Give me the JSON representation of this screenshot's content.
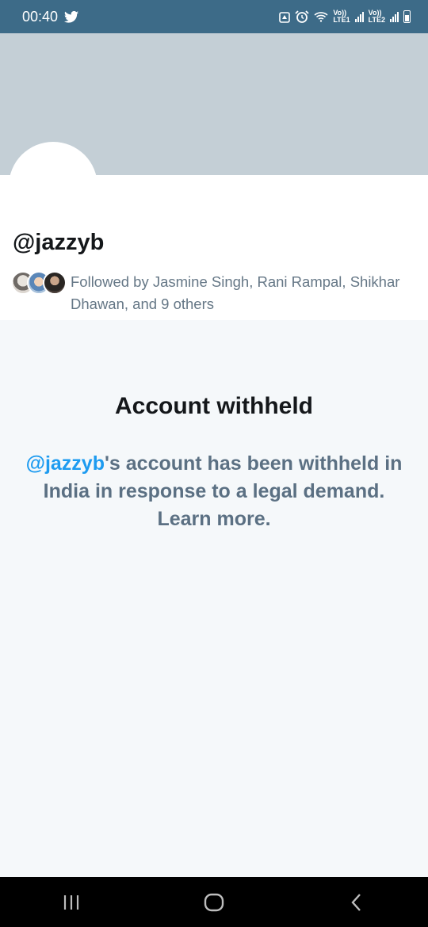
{
  "status_bar": {
    "time": "00:40",
    "sim1_top": "Vo))",
    "sim1_bottom": "LTE1",
    "sim2_top": "Vo))",
    "sim2_bottom": "LTE2"
  },
  "profile": {
    "handle": "@jazzyb",
    "followed_by": "Followed by Jasmine Singh, Rani Rampal, Shikhar Dhawan, and 9 others"
  },
  "withheld": {
    "title": "Account withheld",
    "mention": "@jazzyb",
    "message": "'s account has been withheld in India in response to a legal demand. Learn more."
  },
  "colors": {
    "status_bar": "#3d6b88",
    "banner": "#c4cfd6",
    "accent": "#1d9bf0",
    "secondary_text": "#657786"
  },
  "icons": [
    "twitter-bird-icon",
    "alarm-lock-icon",
    "alarm-clock-icon",
    "wifi-icon",
    "signal-icon",
    "battery-icon",
    "recent-apps-icon",
    "home-icon",
    "back-icon"
  ]
}
